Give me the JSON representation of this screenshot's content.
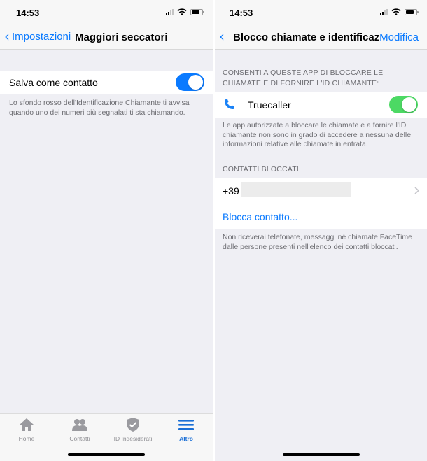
{
  "left": {
    "status": {
      "time": "14:53"
    },
    "nav": {
      "back_label": "Impostazioni",
      "title": "Maggiori seccatori"
    },
    "setting": {
      "label": "Salva come contatto",
      "toggle_on": true,
      "description": "Lo sfondo rosso dell'Identificazione Chiamante ti avvisa quando uno dei numeri più segnalati ti sta chiamando."
    },
    "tabs": [
      {
        "label": "Home",
        "icon": "home-icon",
        "active": false
      },
      {
        "label": "Contatti",
        "icon": "contacts-icon",
        "active": false
      },
      {
        "label": "ID Indesiderati",
        "icon": "shield-icon",
        "active": false
      },
      {
        "label": "Altro",
        "icon": "menu-icon",
        "active": true
      }
    ]
  },
  "right": {
    "status": {
      "time": "14:53"
    },
    "nav": {
      "title": "Blocco chiamate e identificazi...",
      "action_label": "Modifica"
    },
    "section_apps": {
      "header": "CONSENTI A QUESTE APP DI BLOCCARE LE CHIAMATE E DI FORNIRE L'ID CHIAMANTE:",
      "app_name": "Truecaller",
      "app_icon": "phone-icon",
      "toggle_on": true,
      "footer": "Le app autorizzate a bloccare le chiamate e a fornire l'ID chiamante non sono in grado di accedere a nessuna delle informazioni relative alle chiamate in entrata."
    },
    "section_blocked": {
      "header": "CONTATTI BLOCCATI",
      "number_prefix": "+39",
      "block_action": "Blocca contatto...",
      "footer": "Non riceverai telefonate, messaggi né chiamate FaceTime dalle persone presenti nell'elenco dei contatti bloccati."
    }
  },
  "colors": {
    "accent": "#0a7aff",
    "toggle_blue": "#0a7aff",
    "toggle_green": "#4cd964",
    "background": "#efeff4",
    "active_tab": "#1a6fd6"
  }
}
